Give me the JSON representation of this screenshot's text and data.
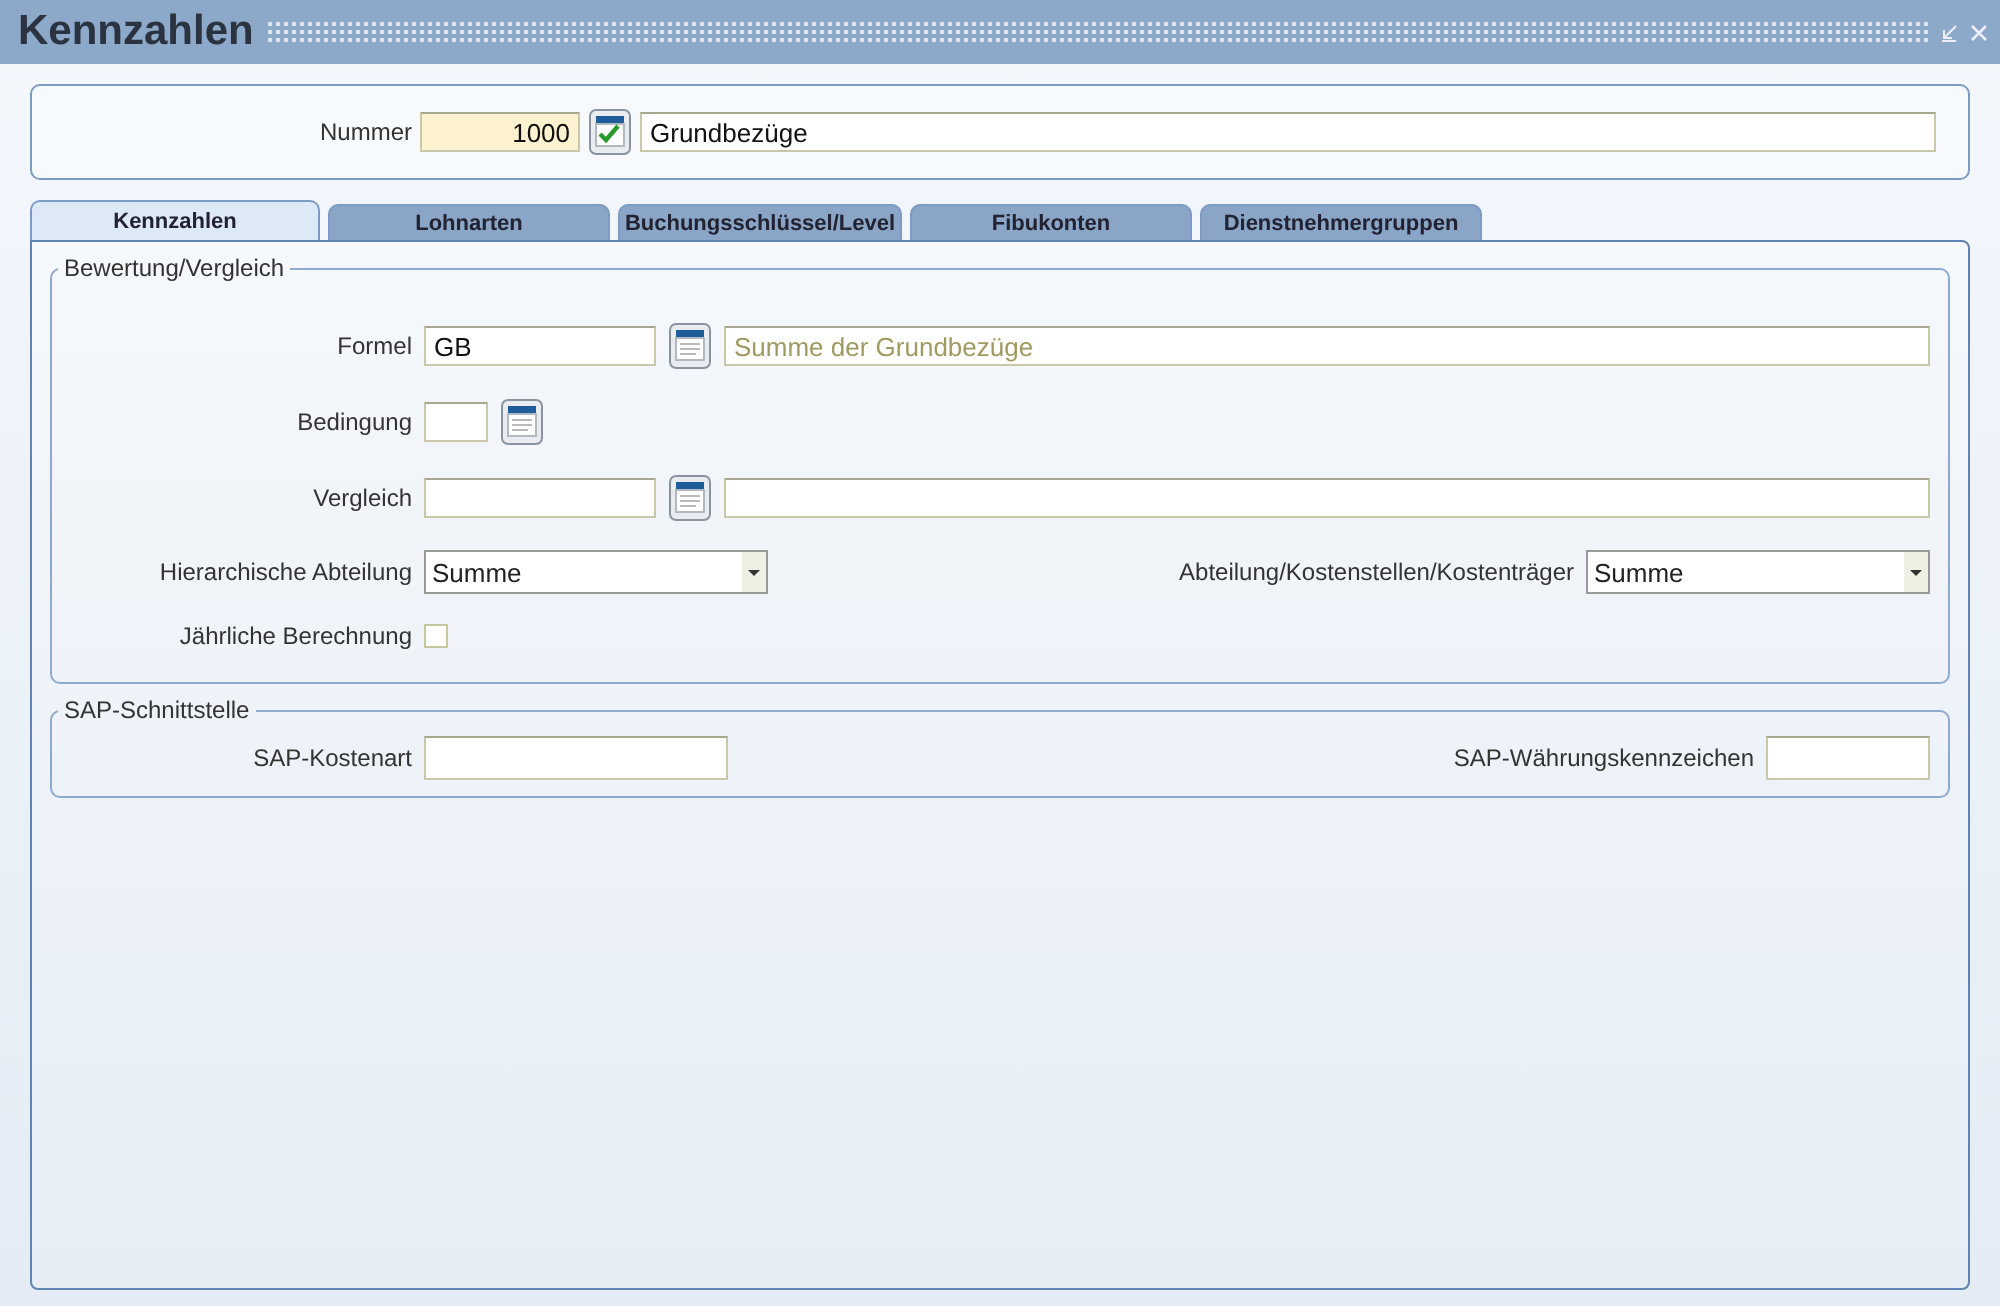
{
  "window": {
    "title": "Kennzahlen"
  },
  "header": {
    "nummer_label": "Nummer",
    "nummer_value": "1000",
    "name_value": "Grundbezüge"
  },
  "tabs": [
    {
      "label": "Kennzahlen",
      "selected": true
    },
    {
      "label": "Lohnarten",
      "selected": false
    },
    {
      "label": "Buchungsschlüssel/Level",
      "selected": false
    },
    {
      "label": "Fibukonten",
      "selected": false
    },
    {
      "label": "Dienstnehmergruppen",
      "selected": false
    }
  ],
  "bewertung": {
    "title": "Bewertung/Vergleich",
    "formel": {
      "label": "Formel",
      "value": "GB",
      "description": "Summe der Grundbezüge"
    },
    "bedingung": {
      "label": "Bedingung"
    },
    "vergleich": {
      "label": "Vergleich"
    },
    "hierarchie": {
      "label": "Hierarchische Abteilung",
      "value": "Summe"
    },
    "kostenstellen": {
      "label": "Abteilung/Kostenstellen/Kostenträger",
      "value": "Summe"
    },
    "jaehrlich": {
      "label": "Jährliche Berechnung",
      "checked": false
    }
  },
  "sap": {
    "title": "SAP-Schnittstelle",
    "kostenart": {
      "label": "SAP-Kostenart"
    },
    "waehrung": {
      "label": "SAP-Währungskennzeichen"
    }
  }
}
